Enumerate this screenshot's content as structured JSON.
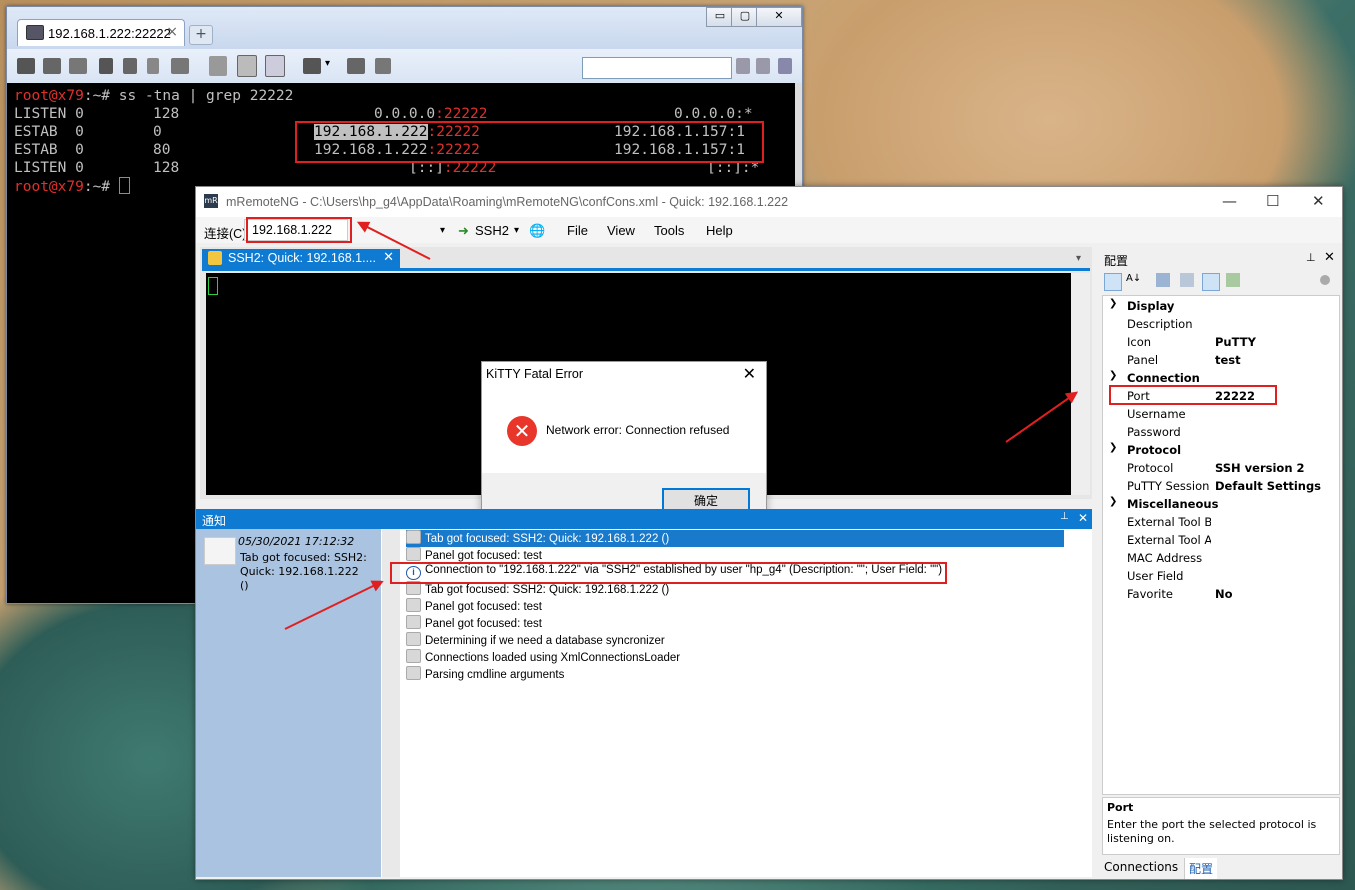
{
  "putty": {
    "tab_title": "192.168.1.222:22222",
    "tab_close": "×",
    "add_tab": "+",
    "window_controls": [
      "▭",
      "▢",
      "✕"
    ],
    "terminal": {
      "lines": [
        {
          "prompt": "root@x79",
          "rest": ":~# ss -tna | grep 22222"
        },
        {
          "col1": "LISTEN 0",
          "col2": "128",
          "local_ip": "0.0.0.0",
          "local_port": ":22222",
          "peer": "0.0.0.0:*"
        },
        {
          "col1": "ESTAB  0",
          "col2": "0",
          "local_ip": "192.168.1.222",
          "local_port": ":22222",
          "peer": "192.168.1.157:1"
        },
        {
          "col1": "ESTAB  0",
          "col2": "80",
          "local_ip": "192.168.1.222",
          "local_port": ":22222",
          "peer": "192.168.1.157:1"
        },
        {
          "col1": "LISTEN 0",
          "col2": "128",
          "local_ip": "[::]",
          "local_port": ":22222",
          "peer": "[::]:*"
        },
        {
          "prompt": "root@x79",
          "rest": ":~# "
        }
      ]
    }
  },
  "mremote": {
    "title": "mRemoteNG - C:\\Users\\hp_g4\\AppData\\Roaming\\mRemoteNG\\confCons.xml - Quick: 192.168.1.222",
    "logo": "mR",
    "window_controls": [
      "—",
      "☐",
      "✕"
    ],
    "connect_label": "连接(C)",
    "connect_value": "192.168.1.222",
    "protocol": "SSH2",
    "menu": [
      "File",
      "View",
      "Tools",
      "Help"
    ],
    "doc_tab": "SSH2: Quick: 192.168.1....",
    "doc_tab_close": "✕",
    "dialog": {
      "title": "KiTTY Fatal Error",
      "close": "✕",
      "message": "Network error: Connection refused",
      "ok": "确定"
    },
    "notifications": {
      "header": "通知",
      "pin": "📌",
      "close": "✕",
      "detail_time": "05/30/2021 17:12:32",
      "detail_text": "Tab got focused: SSH2: Quick: 192.168.1.222 ()",
      "items": [
        {
          "text": "Tab got focused: SSH2: Quick: 192.168.1.222 ()",
          "type": "info",
          "selected": true
        },
        {
          "text": "Panel got focused: test",
          "type": "msg"
        },
        {
          "text": "Connection to \"192.168.1.222\" via \"SSH2\" established by user \"hp_g4\" (Description: \"\"; User Field: \"\")",
          "type": "info-i"
        },
        {
          "text": "Tab got focused: SSH2: Quick: 192.168.1.222 ()",
          "type": "msg"
        },
        {
          "text": "Panel got focused: test",
          "type": "msg"
        },
        {
          "text": "Panel got focused: test",
          "type": "msg"
        },
        {
          "text": "Determining if we need a database syncronizer",
          "type": "msg"
        },
        {
          "text": "Connections loaded using XmlConnectionsLoader",
          "type": "msg"
        },
        {
          "text": "Parsing cmdline arguments",
          "type": "msg"
        }
      ]
    },
    "config": {
      "header": "配置",
      "pin": "📌",
      "close": "✕",
      "categories": [
        {
          "name": "Display",
          "props": [
            [
              "Description",
              ""
            ],
            [
              "Icon",
              "PuTTY"
            ],
            [
              "Panel",
              "test"
            ]
          ]
        },
        {
          "name": "Connection",
          "props": [
            [
              "Port",
              "22222"
            ],
            [
              "Username",
              ""
            ],
            [
              "Password",
              ""
            ]
          ]
        },
        {
          "name": "Protocol",
          "props": [
            [
              "Protocol",
              "SSH version 2"
            ],
            [
              "PuTTY Session",
              "Default Settings"
            ]
          ]
        },
        {
          "name": "Miscellaneous",
          "props": [
            [
              "External Tool Bef",
              ""
            ],
            [
              "External Tool Aft",
              ""
            ],
            [
              "MAC Address",
              ""
            ],
            [
              "User Field",
              ""
            ],
            [
              "Favorite",
              "No"
            ]
          ]
        }
      ],
      "desc_title": "Port",
      "desc_text": "Enter the port the selected protocol is listening on.",
      "tabs": [
        "Connections",
        "配置"
      ]
    }
  }
}
